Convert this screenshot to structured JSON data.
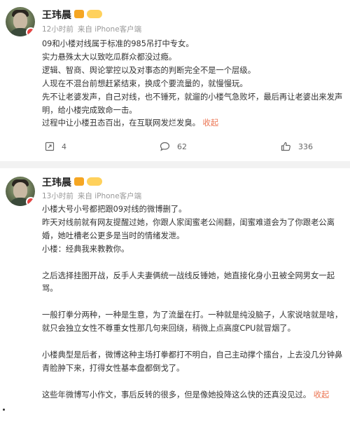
{
  "post1": {
    "author": "王玮晨",
    "time": "12小时前",
    "source": "来自 iPhone客户端",
    "lines": [
      "09和小楼对线属于标准的985吊打中专女。",
      "实力悬殊太大以致吃瓜群众都没过瘾。",
      "逻辑、智商、舆论掌控以及对事态的判断完全不是一个层级。",
      "人现在不混台前想赶紧结束，换成个要流量的，就慢慢玩。",
      "先不让老婆发声，自己对线，也不锤死，就遛的小楼气急败坏，最后再让老婆出来发声明，给小楼完成致命一击。",
      "过程中让小楼丑态百出，在互联网发烂发臭。"
    ],
    "collapse": "收起",
    "repost_count": "4",
    "comment_count": "62",
    "like_count": "336"
  },
  "post2": {
    "author": "王玮晨",
    "time": "13小时前",
    "source": "来自 iPhone客户端",
    "paragraphs": [
      "小楼大号小号都把跟09对线的微博删了。",
      "昨天对线前就有网友提醒过她，你跟人家闺蜜老公闹翻，闺蜜难道会为了你跟老公离婚，她吐槽老公更多是当时的情绪发泄。",
      "小楼：经典我来教教你。",
      "",
      "之后选择挂图开战，反手人夫妻俩统一战线反锤她，她直接化身小丑被全网男女一起骂。",
      "",
      "一般打拳分两种，一种是生意，为了流量在打。一种就是纯没脑子，人家说啥就是啥，就只会独立女性不尊重女性那几句来回绕，稍微上点高度CPU就冒烟了。",
      "",
      "小楼典型是后者，微博这种主场打拳都打不明白，自己主动撑个擂台，上去没几分钟鼻青脸肿下来，打得女性基本盘都倒戈了。",
      "",
      "这些年微博写小作文，事后反转的很多，但是像她投降这么快的还真没见过。"
    ],
    "collapse": "收起"
  }
}
